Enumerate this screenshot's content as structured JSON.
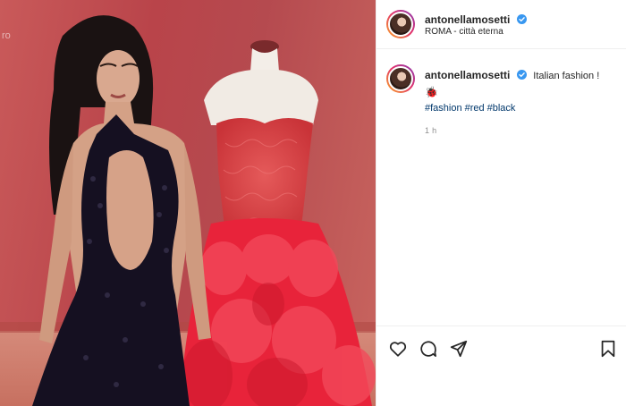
{
  "photo": {
    "wall_text": "ro"
  },
  "post": {
    "username": "antonellamosetti",
    "location": "ROMA - città eterna",
    "caption_text": "Italian fashion !",
    "caption_emoji": "🐞",
    "hashtags": [
      "#fashion",
      "#red",
      "#black"
    ],
    "timestamp": "1 h"
  },
  "actions": {
    "icons": [
      "heart-icon",
      "comment-icon",
      "share-icon",
      "bookmark-icon"
    ]
  },
  "colors": {
    "verified_badge": "#3897f0",
    "hashtag_link": "#00376b",
    "muted_text": "#8e8e8e",
    "divider": "#efefef"
  }
}
